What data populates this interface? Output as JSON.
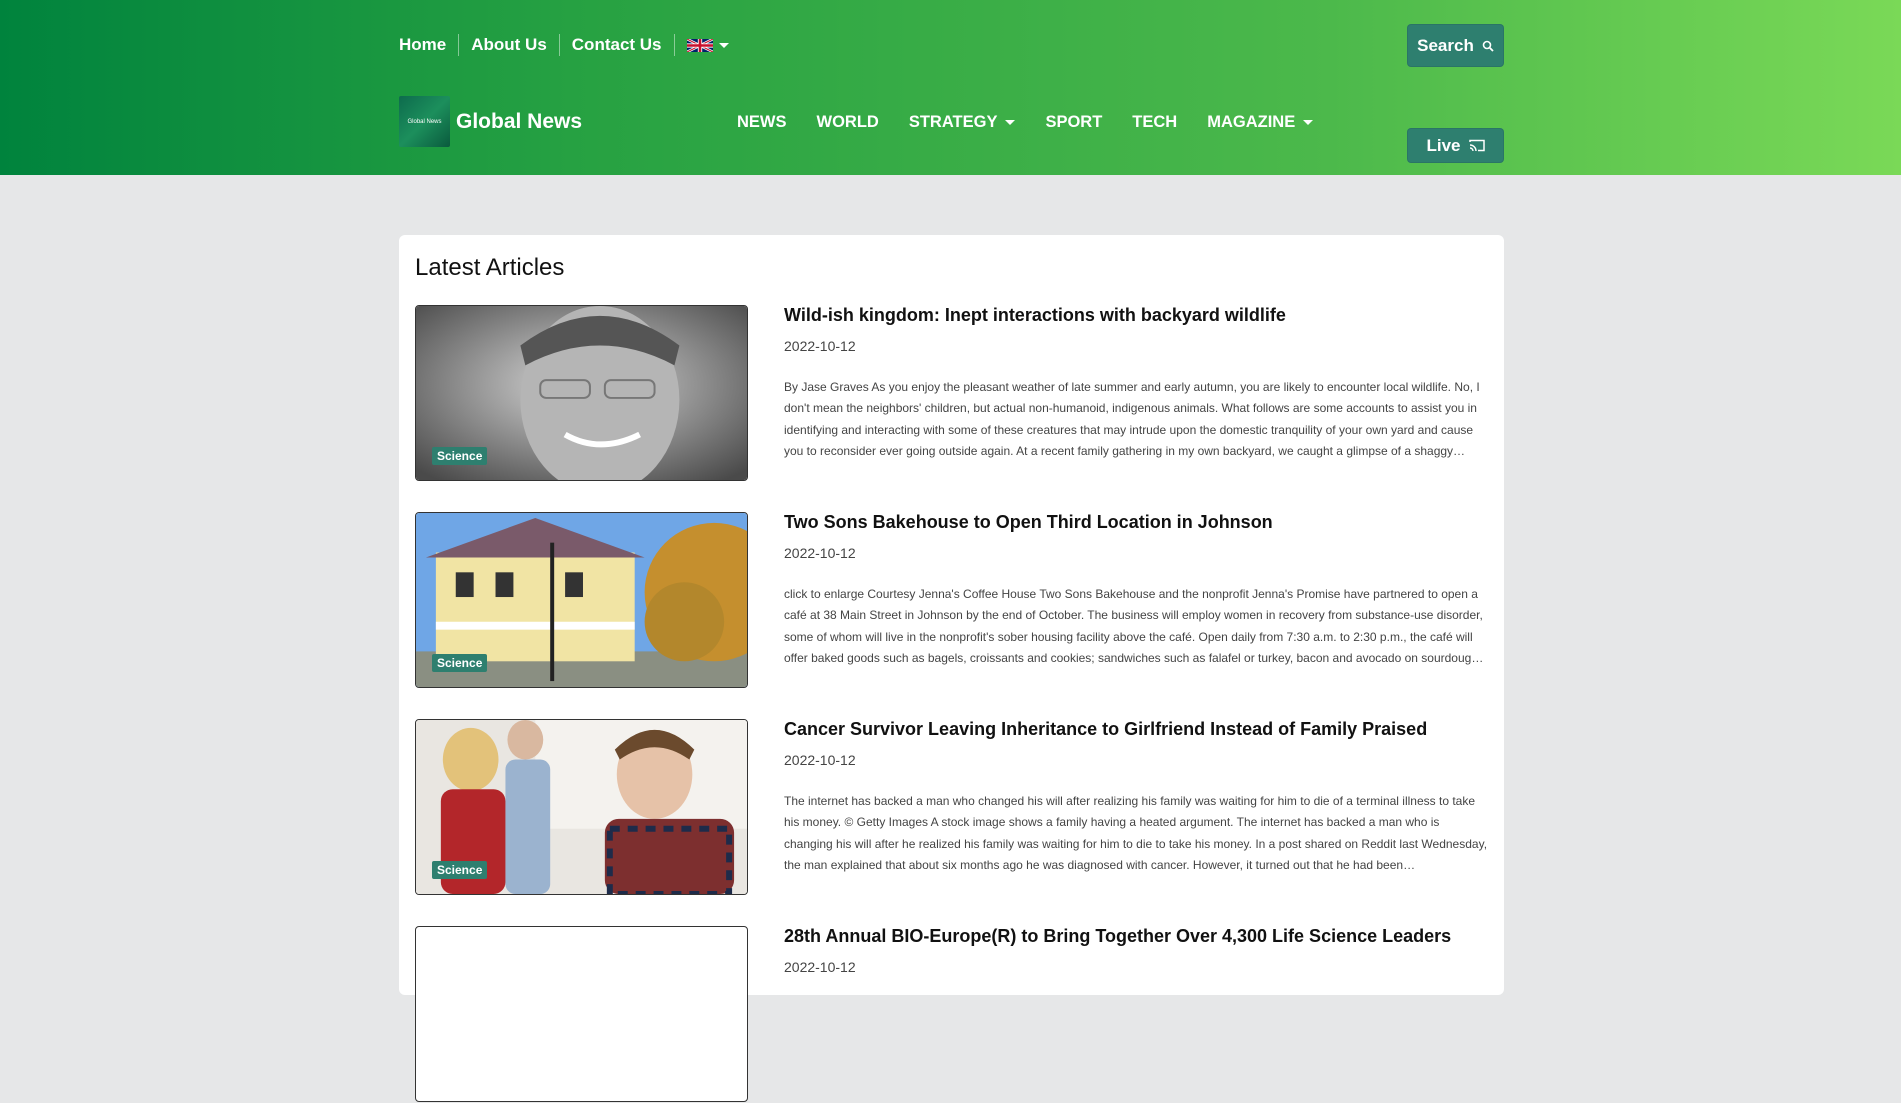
{
  "topnav": {
    "home": "Home",
    "about": "About Us",
    "contact": "Contact Us",
    "language_icon": "uk-flag-icon"
  },
  "buttons": {
    "search": "Search",
    "search_icon": "search-icon",
    "live": "Live",
    "live_icon": "cast-icon"
  },
  "brand": {
    "logo_text": "Global News",
    "name": "Global News"
  },
  "mainnav": {
    "news": "NEWS",
    "world": "WORLD",
    "strategy": "STRATEGY",
    "sport": "SPORT",
    "tech": "TECH",
    "magazine": "MAGAZINE"
  },
  "colors": {
    "header_gradient_start": "#00833d",
    "header_gradient_end": "#7ad957",
    "accent": "#2e7f6f",
    "page_bg": "#e6e7e8"
  },
  "latest": {
    "title": "Latest Articles",
    "articles": [
      {
        "tag": "Science",
        "title": "Wild-ish kingdom: Inept interactions with backyard wildlife",
        "date": "2022-10-12",
        "body": "By Jase Graves As you enjoy the pleasant weather of late summer and early autumn, you are likely to encounter local wildlife. No, I don't mean the neighbors' children, but actual non-humanoid, indigenous animals. What follows are some accounts to assist you in identifying and interacting with some of these creatures that may intrude upon the domestic tranquility of your own yard and cause you to reconsider ever going outside again. At a recent family gathering in my own backyard, we caught a glimpse of a shaggy…"
      },
      {
        "tag": "Science",
        "title": "Two Sons Bakehouse to Open Third Location in Johnson",
        "date": "2022-10-12",
        "body": "click to enlarge Courtesy Jenna's Coffee House Two Sons Bakehouse and the nonprofit Jenna's Promise have partnered to open a café at 38 Main Street in Johnson by the end of October. The business will employ women in recovery from substance-use disorder, some of whom will live in the nonprofit's sober housing facility above the café. Open daily from 7:30 a.m. to 2:30 p.m., the café will offer baked goods such as bagels, croissants and cookies; sandwiches such as falafel or turkey, bacon and avocado on sourdoug…"
      },
      {
        "tag": "Science",
        "title": "Cancer Survivor Leaving Inheritance to Girlfriend Instead of Family Praised",
        "date": "2022-10-12",
        "body": "The internet has backed a man who changed his will after realizing his family was waiting for him to die of a terminal illness to take his money. © Getty Images A stock image shows a family having a heated argument. The internet has backed a man who is changing his will after he realized his family was waiting for him to die to take his money. In a post shared on Reddit last Wednesday, the man explained that about six months ago he was diagnosed with cancer. However, it turned out that he had been…"
      },
      {
        "tag": "",
        "title": "28th Annual BIO-Europe(R) to Bring Together Over 4,300 Life Science Leaders",
        "date": "2022-10-12",
        "body": ""
      }
    ]
  }
}
